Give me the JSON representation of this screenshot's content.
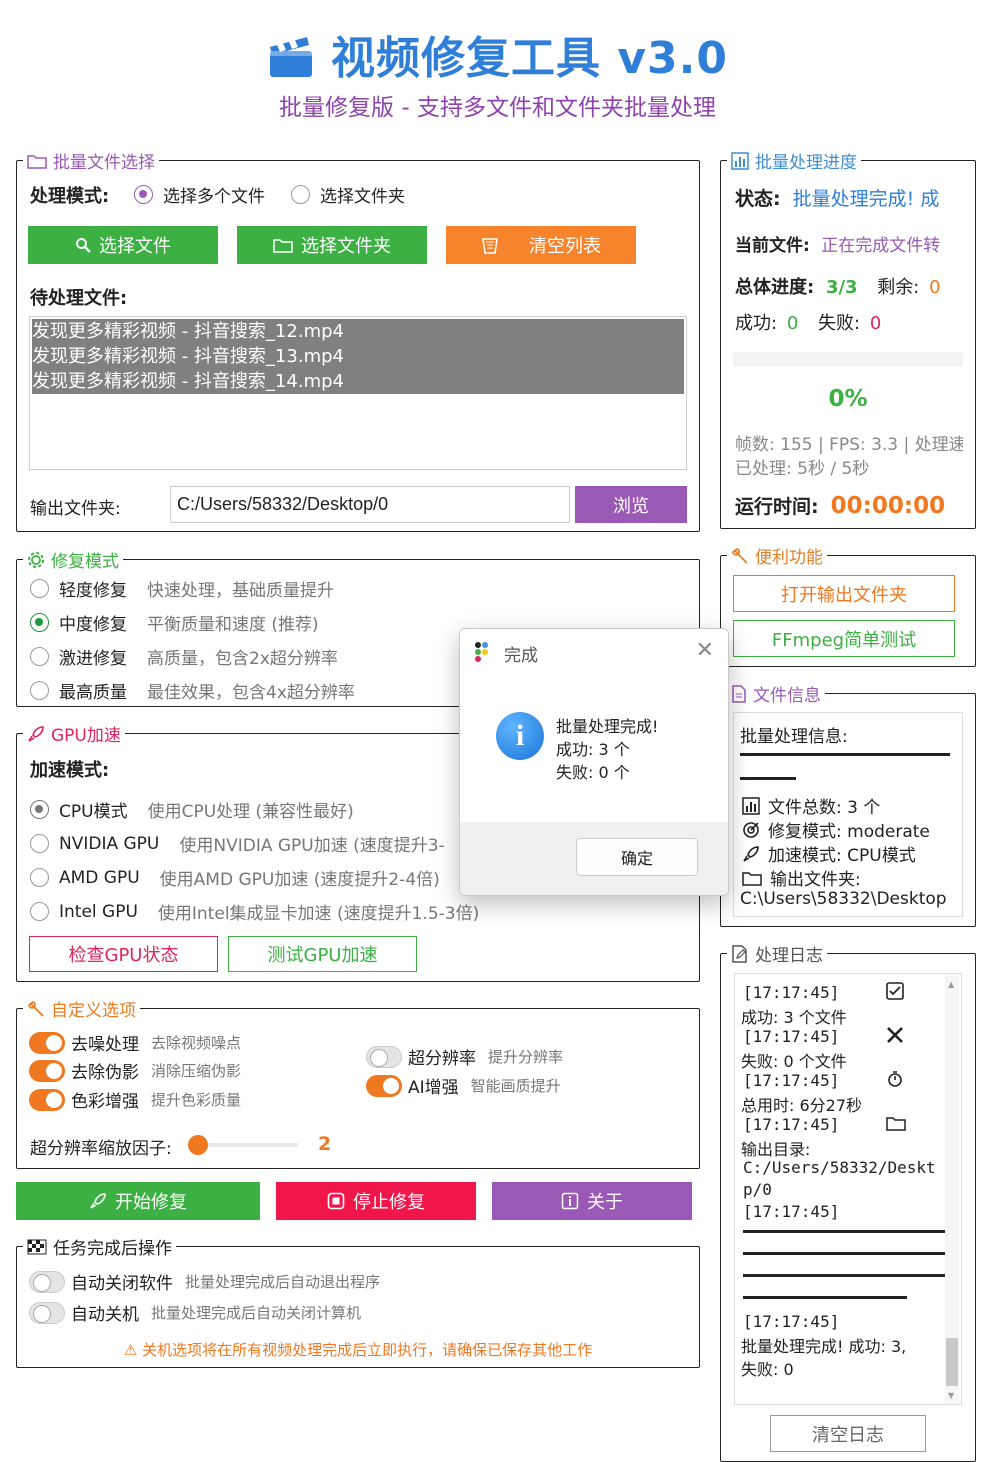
{
  "app": {
    "title": "视频修复工具 v3.0",
    "subtitle": "批量修复版 - 支持多文件和文件夹批量处理",
    "accent": "#2f7fd8"
  },
  "file_select": {
    "legend": "批量文件选择",
    "mode_label": "处理模式:",
    "mode_options": [
      "选择多个文件",
      "选择文件夹"
    ],
    "mode_selected": "选择多个文件",
    "btn_select_files": "选择文件",
    "btn_select_folder": "选择文件夹",
    "btn_clear": "清空列表",
    "pending_label": "待处理文件:",
    "files": [
      "发现更多精彩视频 - 抖音搜索_12.mp4",
      "发现更多精彩视频 - 抖音搜索_13.mp4",
      "发现更多精彩视频 - 抖音搜索_14.mp4"
    ],
    "output_label": "输出文件夹:",
    "output_value": "C:/Users/58332/Desktop/0",
    "btn_browse": "浏览"
  },
  "repair_mode": {
    "legend": "修复模式",
    "options": [
      {
        "label": "轻度修复",
        "desc": "快速处理，基础质量提升"
      },
      {
        "label": "中度修复",
        "desc": "平衡质量和速度 (推荐)"
      },
      {
        "label": "激进修复",
        "desc": "高质量，包含2x超分辨率"
      },
      {
        "label": "最高质量",
        "desc": "最佳效果，包含4x超分辨率"
      }
    ],
    "selected": "中度修复"
  },
  "gpu": {
    "legend": "GPU加速",
    "mode_label": "加速模式:",
    "options": [
      {
        "label": "CPU模式",
        "desc": "使用CPU处理 (兼容性最好)"
      },
      {
        "label": "NVIDIA GPU",
        "desc": "使用NVIDIA GPU加速 (速度提升3-"
      },
      {
        "label": "AMD GPU",
        "desc": "使用AMD GPU加速 (速度提升2-4倍)"
      },
      {
        "label": "Intel GPU",
        "desc": "使用Intel集成显卡加速 (速度提升1.5-3倍)"
      }
    ],
    "selected": "CPU模式",
    "btn_check": "检查GPU状态",
    "btn_test": "测试GPU加速"
  },
  "custom": {
    "legend": "自定义选项",
    "toggles_left": [
      {
        "label": "去噪处理",
        "desc": "去除视频噪点",
        "on": true
      },
      {
        "label": "去除伪影",
        "desc": "消除压缩伪影",
        "on": true
      },
      {
        "label": "色彩增强",
        "desc": "提升色彩质量",
        "on": true
      }
    ],
    "toggles_right": [
      {
        "label": "超分辨率",
        "desc": "提升分辨率",
        "on": false
      },
      {
        "label": "AI增强",
        "desc": "智能画质提升",
        "on": true
      }
    ],
    "scale_label": "超分辨率缩放因子:",
    "scale_value": "2",
    "scale_fraction": 0.0
  },
  "actions": {
    "start": "开始修复",
    "stop": "停止修复",
    "about": "关于"
  },
  "after_task": {
    "legend": "任务完成后操作",
    "options": [
      {
        "label": "自动关闭软件",
        "desc": "批量处理完成后自动退出程序",
        "on": false
      },
      {
        "label": "自动关机",
        "desc": "批量处理完成后自动关闭计算机",
        "on": false
      }
    ],
    "warning": "关机选项将在所有视频处理完成后立即执行，请确保已保存其他工作"
  },
  "progress": {
    "legend": "批量处理进度",
    "status_label": "状态:",
    "status_value": "批量处理完成! 成",
    "current_label": "当前文件:",
    "current_value": "正在完成文件转",
    "total_label": "总体进度:",
    "total_value": "3/3",
    "remain_label": "剩余:",
    "remain_value": "0",
    "success_label": "成功:",
    "success_value": "0",
    "fail_label": "失败:",
    "fail_value": "0",
    "percent": "0%",
    "frames_line": "帧数: 155 | FPS: 3.3 | 处理速",
    "processed_line": "已处理: 5秒 / 5秒",
    "runtime_label": "运行时间:",
    "runtime_value": "00:00:00"
  },
  "convenience": {
    "legend": "便利功能",
    "btn_open_output": "打开输出文件夹",
    "btn_ffmpeg": "FFmpeg简单测试"
  },
  "file_info": {
    "legend": "文件信息",
    "heading": "批量处理信息:",
    "total": "文件总数: 3 个",
    "mode": "修复模式: moderate",
    "accel": "加速模式: CPU模式",
    "out_label": "输出文件夹:",
    "out_path": "C:\\Users\\58332\\Desktop"
  },
  "log": {
    "legend": "处理日志",
    "ts": "[17:17:45]",
    "success": "成功: 3 个文件",
    "fail": "失败: 0 个文件",
    "elapsed": "总用时: 6分27秒",
    "outdir_label": "输出目录:",
    "outdir_path1": "C:/Users/58332/Deskt",
    "outdir_path2": "p/0",
    "final1": "批量处理完成! 成功: 3,",
    "final2": "失败: 0",
    "btn_clear": "清空日志"
  },
  "dialog": {
    "title": "完成",
    "line1": "批量处理完成!",
    "line2": "成功: 3 个",
    "line3": "失败: 0 个",
    "btn_ok": "确定"
  }
}
